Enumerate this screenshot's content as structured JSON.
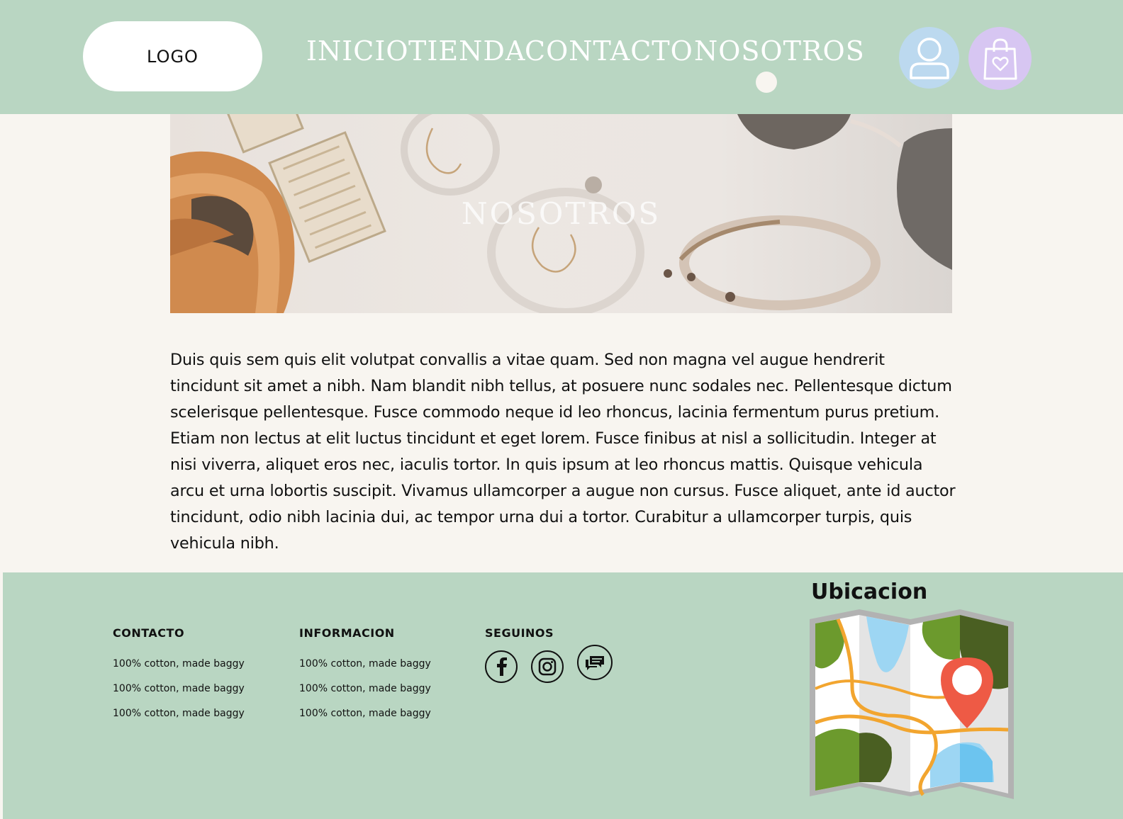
{
  "header": {
    "logo": "LOGO",
    "nav": [
      "INICIO",
      "TIENDA",
      "CONTACTO",
      "NOSOTROS"
    ],
    "active": "NOSOTROS",
    "icons": [
      "user-icon",
      "shopping-bag-heart-icon"
    ],
    "colors": {
      "header_bg": "#b9d6c2",
      "user_btn": "#bcd9ef",
      "cart_btn": "#d7c6f2"
    }
  },
  "hero": {
    "title": "NOSOTROS"
  },
  "content": {
    "paragraph": "Duis quis sem quis elit volutpat convallis a vitae quam. Sed non magna vel augue hendrerit tincidunt sit amet a nibh. Nam blandit nibh tellus, at posuere nunc sodales nec. Pellentesque dictum scelerisque pellentesque. Fusce commodo neque id leo rhoncus, lacinia fermentum purus pretium. Etiam non lectus at elit luctus tincidunt et eget lorem. Fusce finibus at nisl a sollicitudin. Integer at nisi viverra, aliquet eros nec, iaculis tortor. In quis ipsum at leo rhoncus mattis. Quisque vehicula arcu et urna lobortis suscipit. Vivamus ullamcorper a augue non cursus. Fusce aliquet, ante id auctor tincidunt, odio nibh lacinia dui, ac tempor urna dui a tortor. Curabitur a ullamcorper turpis, quis vehicula nibh."
  },
  "footer": {
    "contacto": {
      "title": "CONTACTO",
      "items": [
        "100% cotton, made baggy",
        "100% cotton, made baggy",
        "100% cotton, made baggy"
      ]
    },
    "informacion": {
      "title": "INFORMACION",
      "items": [
        "100% cotton, made baggy",
        "100% cotton, made baggy",
        "100% cotton, made baggy"
      ]
    },
    "seguinos": {
      "title": "SEGUINOS",
      "icons": [
        "facebook-icon",
        "instagram-icon",
        "chat-icon"
      ]
    },
    "ubicacion": {
      "title": "Ubicacion",
      "icon": "map-location-icon"
    }
  }
}
